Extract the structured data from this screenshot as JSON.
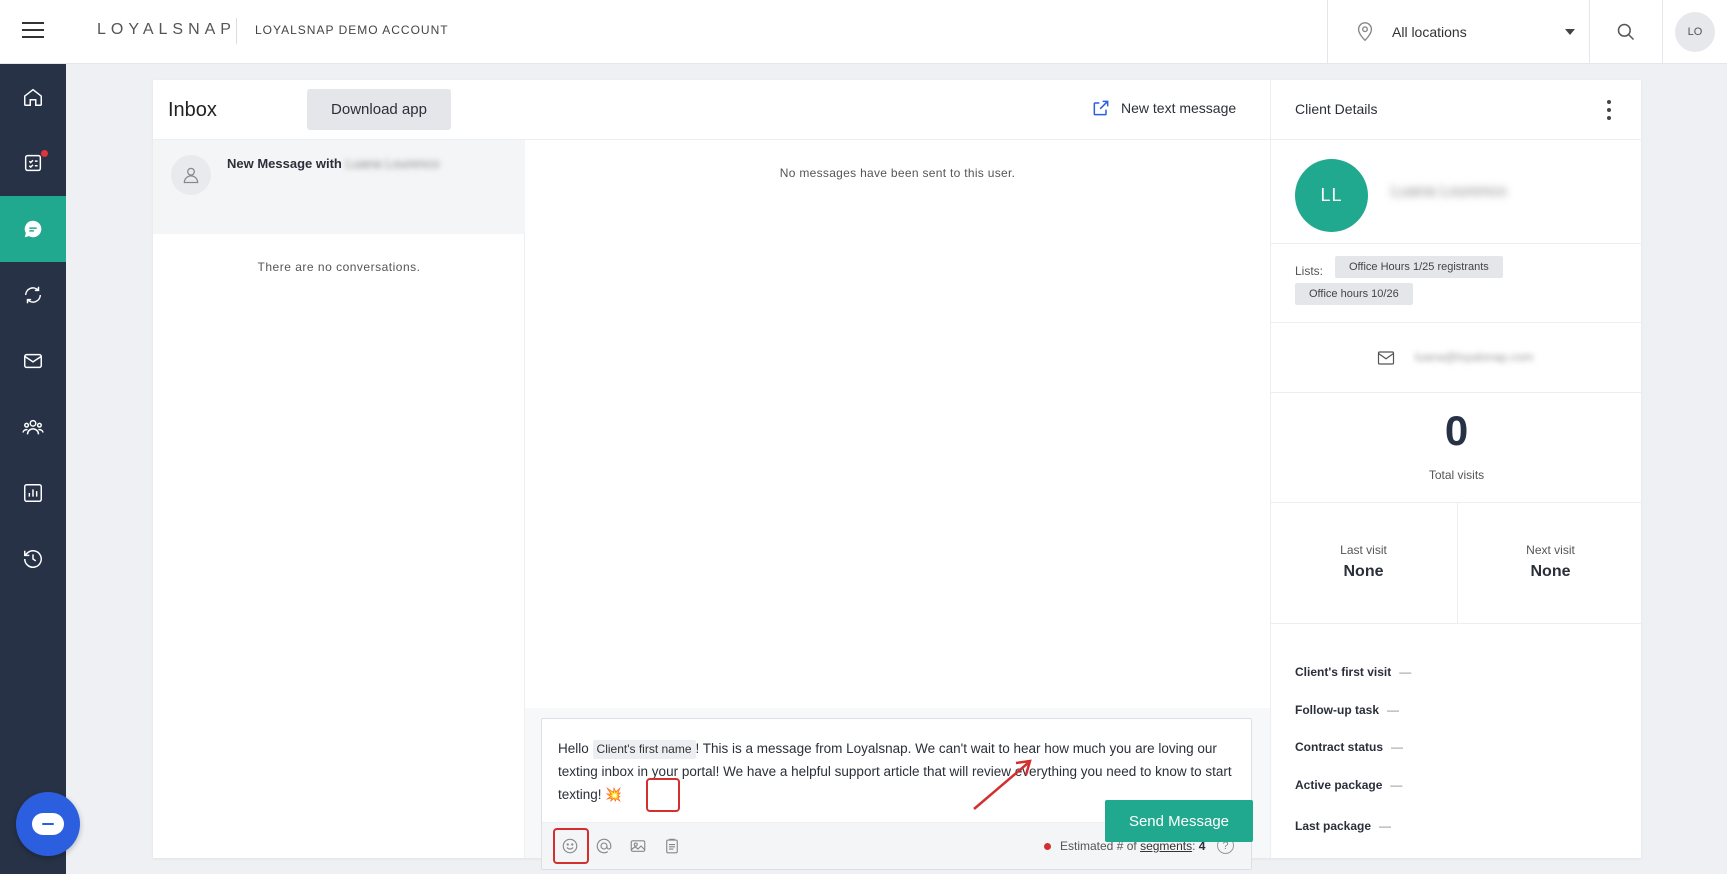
{
  "header": {
    "brand": "LOYALSNAP",
    "account": "LOYALSNAP DEMO ACCOUNT",
    "location": "All locations",
    "user_initials": "LO"
  },
  "sidebar": {
    "items": [
      "home-icon",
      "checklist-icon",
      "chat-icon",
      "sync-icon",
      "mail-icon",
      "people-icon",
      "chart-icon",
      "history-icon"
    ],
    "active": "chat-icon",
    "accent": "#21a98f"
  },
  "inbox": {
    "title": "Inbox",
    "download_label": "Download app",
    "new_text_label": "New text message",
    "conversation_title": "New Message with",
    "conversation_name": "Luana Lourenco",
    "empty_conversations": "There are no conversations.",
    "empty_messages": "No messages have been sent to this user."
  },
  "composer": {
    "text_before": "Hello",
    "chip": "Client's first name",
    "text_after": "! This is a message from Loyalsnap. We can't wait to hear how much you are loving our texting inbox in your portal! We have a helpful support article that will review everything you need to know to start texting!",
    "emoji": "💥",
    "segments_prefix": "Estimated # of",
    "segments_link": "segments",
    "segments_sep": ":",
    "segments_count": "4",
    "help": "?",
    "send_label": "Send Message"
  },
  "details": {
    "title": "Client Details",
    "initials": "LL",
    "name": "Luana Lourenco",
    "lists_label": "Lists:",
    "lists": [
      "Office Hours 1/25 registrants",
      "Office hours 10/26"
    ],
    "email": "luana@loyalsnap.com",
    "total_visits": "0",
    "total_visits_label": "Total visits",
    "last_visit_label": "Last visit",
    "last_visit": "None",
    "next_visit_label": "Next visit",
    "next_visit": "None",
    "fields": [
      {
        "label": "Client's first visit",
        "value": "—"
      },
      {
        "label": "Follow-up task",
        "value": "—"
      },
      {
        "label": "Contract status",
        "value": "—"
      },
      {
        "label": "Active package",
        "value": "—"
      },
      {
        "label": "Last package",
        "value": "—"
      }
    ]
  }
}
